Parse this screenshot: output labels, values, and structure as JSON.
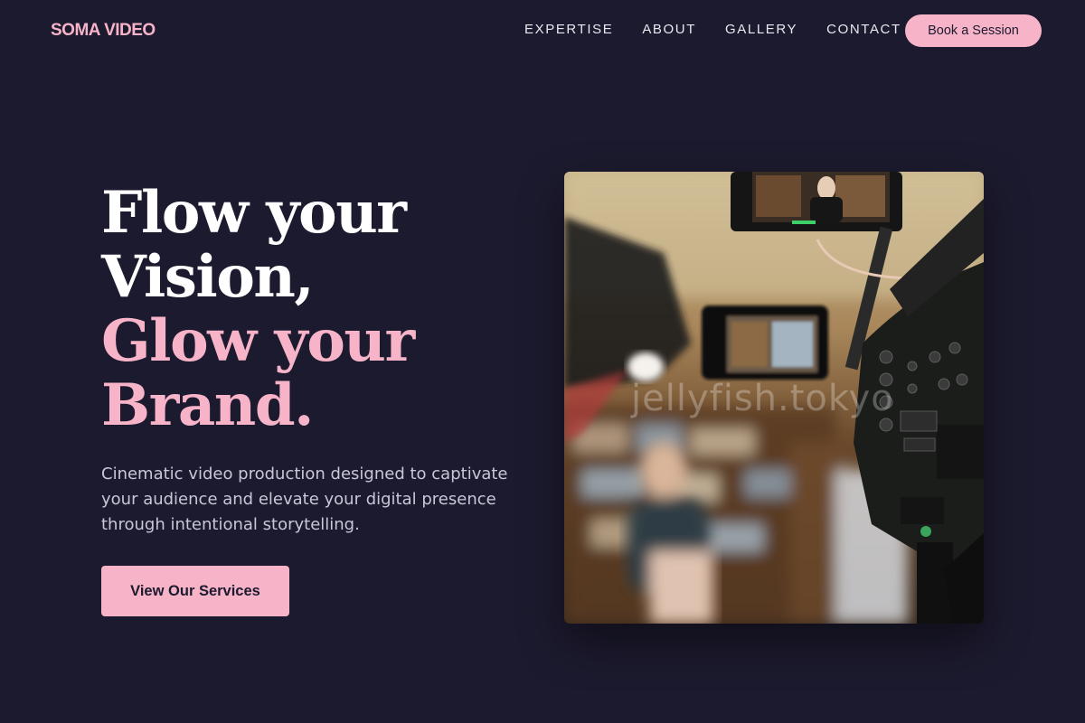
{
  "brand": {
    "logo": "SOMA VIDEO"
  },
  "nav": {
    "items": [
      {
        "label": "EXPERTISE"
      },
      {
        "label": "ABOUT"
      },
      {
        "label": "GALLERY"
      },
      {
        "label": "CONTACT"
      }
    ],
    "cta_label": "Book a Session"
  },
  "hero": {
    "title_line1": "Flow your",
    "title_line2": "Vision,",
    "title_line3": "Glow your",
    "title_line4": "Brand.",
    "subtitle": "Cinematic video production designed to captivate your audience and elevate your digital presence through intentional storytelling.",
    "cta_label": "View Our Services",
    "image_watermark": "jellyfish.tokyo"
  },
  "colors": {
    "background": "#1c1a2e",
    "accent": "#f7b3c8",
    "text": "#ffffff",
    "muted_text": "#c9c6d8"
  }
}
